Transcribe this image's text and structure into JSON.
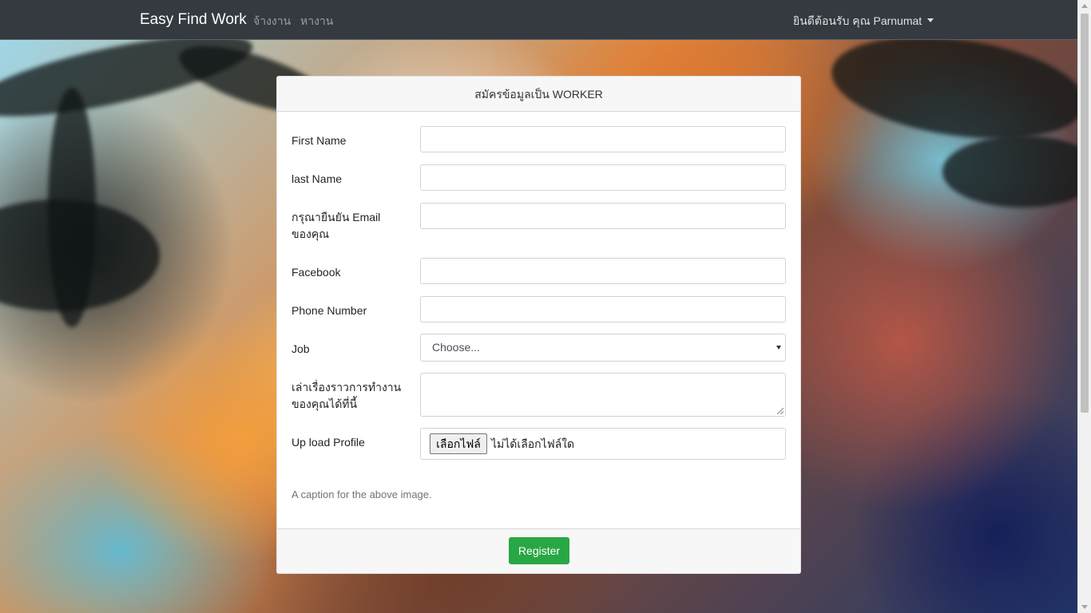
{
  "navbar": {
    "brand": "Easy Find Work",
    "links": [
      "จ้างงาน",
      "หางาน"
    ],
    "user_greeting": "ยินดีต้อนรับ คุณ Parnumat"
  },
  "form": {
    "title": "สมัครข้อมูลเป็น WORKER",
    "fields": {
      "first_name": {
        "label": "First Name",
        "value": ""
      },
      "last_name": {
        "label": "last Name",
        "value": ""
      },
      "email": {
        "label_line1": "กรุณายืนยัน Email",
        "label_line2": "ของคุณ",
        "value": ""
      },
      "facebook": {
        "label": "Facebook",
        "value": ""
      },
      "phone": {
        "label": "Phone Number",
        "value": ""
      },
      "job": {
        "label": "Job",
        "selected": "Choose..."
      },
      "story": {
        "label_line1": "เล่าเรื่องราวการทำงาน",
        "label_line2": "ของคุณได้ที่นี้",
        "value": ""
      },
      "profile": {
        "label": "Up load Profile",
        "button": "เลือกไฟล์",
        "status": "ไม่ได้เลือกไฟล์ใด"
      }
    },
    "caption": "A caption for the above image.",
    "submit_label": "Register"
  },
  "colors": {
    "navbar_bg": "#343a40",
    "register_button": "#28a745"
  }
}
